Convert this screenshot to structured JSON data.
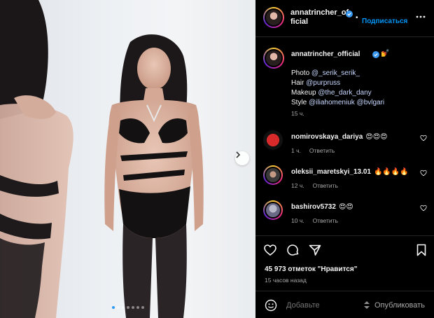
{
  "post": {
    "author": "annatrincher_of\nficial",
    "author_line1": "annatrincher_of",
    "author_line2": "ficial",
    "dot": "•",
    "follow_label": "Подписаться"
  },
  "caption": {
    "username": "annatrincher_official",
    "emoji": "💅",
    "lines": [
      {
        "prefix": "Photo ",
        "mention": "@_serik_serik_",
        "mention2": ""
      },
      {
        "prefix": "Hair ",
        "mention": "@purpruss",
        "mention2": ""
      },
      {
        "prefix": "Makeup ",
        "mention": "@the_dark_dany",
        "mention2": ""
      },
      {
        "prefix": "Style ",
        "mention": "@iliahomeniuk",
        "mention2": "@bvlgari"
      }
    ],
    "time": "15 ч."
  },
  "comments": [
    {
      "user": "nomirovskaya_dariya",
      "text": "😍😍😍",
      "time": "1 ч.",
      "reply": "Ответить"
    },
    {
      "user": "oleksii_maretskyi_13.01",
      "text": "🔥🔥🔥🔥",
      "time": "12 ч.",
      "reply": "Ответить"
    },
    {
      "user": "bashirov5732",
      "text": "😍😍",
      "time": "10 ч.",
      "reply": "Ответить"
    }
  ],
  "stats": {
    "likes": "45 973 отметок \"Нравится\"",
    "ago": "15 часов назад"
  },
  "composer": {
    "placeholder": "Добавьте",
    "publish_label": "Опубликовать"
  },
  "carousel": {
    "total": 7,
    "active_index": 0
  },
  "colors": {
    "accent": "#0095f6",
    "verified": "#3897f0",
    "panel_bg": "#000000",
    "secondary_text": "#a8a8a8"
  },
  "icons": [
    "more-icon",
    "heart-icon",
    "comment-icon",
    "share-icon",
    "bookmark-icon",
    "emoji-icon",
    "verified-icon",
    "chevron-right-icon"
  ]
}
